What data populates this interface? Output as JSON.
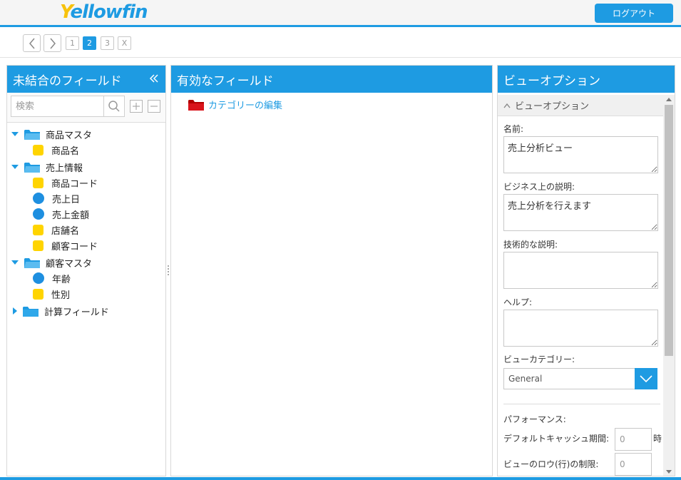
{
  "header": {
    "logo_first": "Y",
    "logo_rest": "ellowfin",
    "logout_label": "ログアウト"
  },
  "stepnav": {
    "pages": [
      "1",
      "2",
      "3",
      "X"
    ],
    "active_page": "2"
  },
  "left_panel": {
    "title": "未結合のフィールド",
    "search_placeholder": "検索",
    "tree": [
      {
        "type": "folder",
        "label": "商品マスタ",
        "expanded": true
      },
      {
        "type": "dimension",
        "label": "商品名"
      },
      {
        "type": "folder",
        "label": "売上情報",
        "expanded": true
      },
      {
        "type": "dimension",
        "label": "商品コード"
      },
      {
        "type": "metric",
        "label": "売上日"
      },
      {
        "type": "metric",
        "label": "売上金額"
      },
      {
        "type": "dimension",
        "label": "店舗名"
      },
      {
        "type": "dimension",
        "label": "顧客コード"
      },
      {
        "type": "folder",
        "label": "顧客マスタ",
        "expanded": true
      },
      {
        "type": "metric",
        "label": "年齢"
      },
      {
        "type": "dimension",
        "label": "性別"
      },
      {
        "type": "folder",
        "label": "計算フィールド",
        "expanded": false
      }
    ]
  },
  "mid_panel": {
    "title": "有効なフィールド",
    "category_link": "カテゴリーの編集"
  },
  "right_panel": {
    "title": "ビューオプション",
    "section_title": "ビューオプション",
    "name_label": "名前:",
    "name_value": "売上分析ビュー",
    "business_label": "ビジネス上の説明:",
    "business_value": "売上分析を行えます",
    "technical_label": "技術的な説明:",
    "technical_value": "",
    "help_label": "ヘルプ:",
    "help_value": "",
    "category_label": "ビューカテゴリー:",
    "category_value": "General",
    "performance_label": "パフォーマンス:",
    "cache_label": "デフォルトキャッシュ期間:",
    "cache_value": "0",
    "cache_unit": "時",
    "row_limit_label": "ビューのロウ(行)の制限:",
    "row_limit_value": "0"
  },
  "colors": {
    "accent": "#1e9be2",
    "dimension": "#ffd400",
    "metric": "#1e8fe0",
    "logo_yellow": "#f7c20c"
  }
}
